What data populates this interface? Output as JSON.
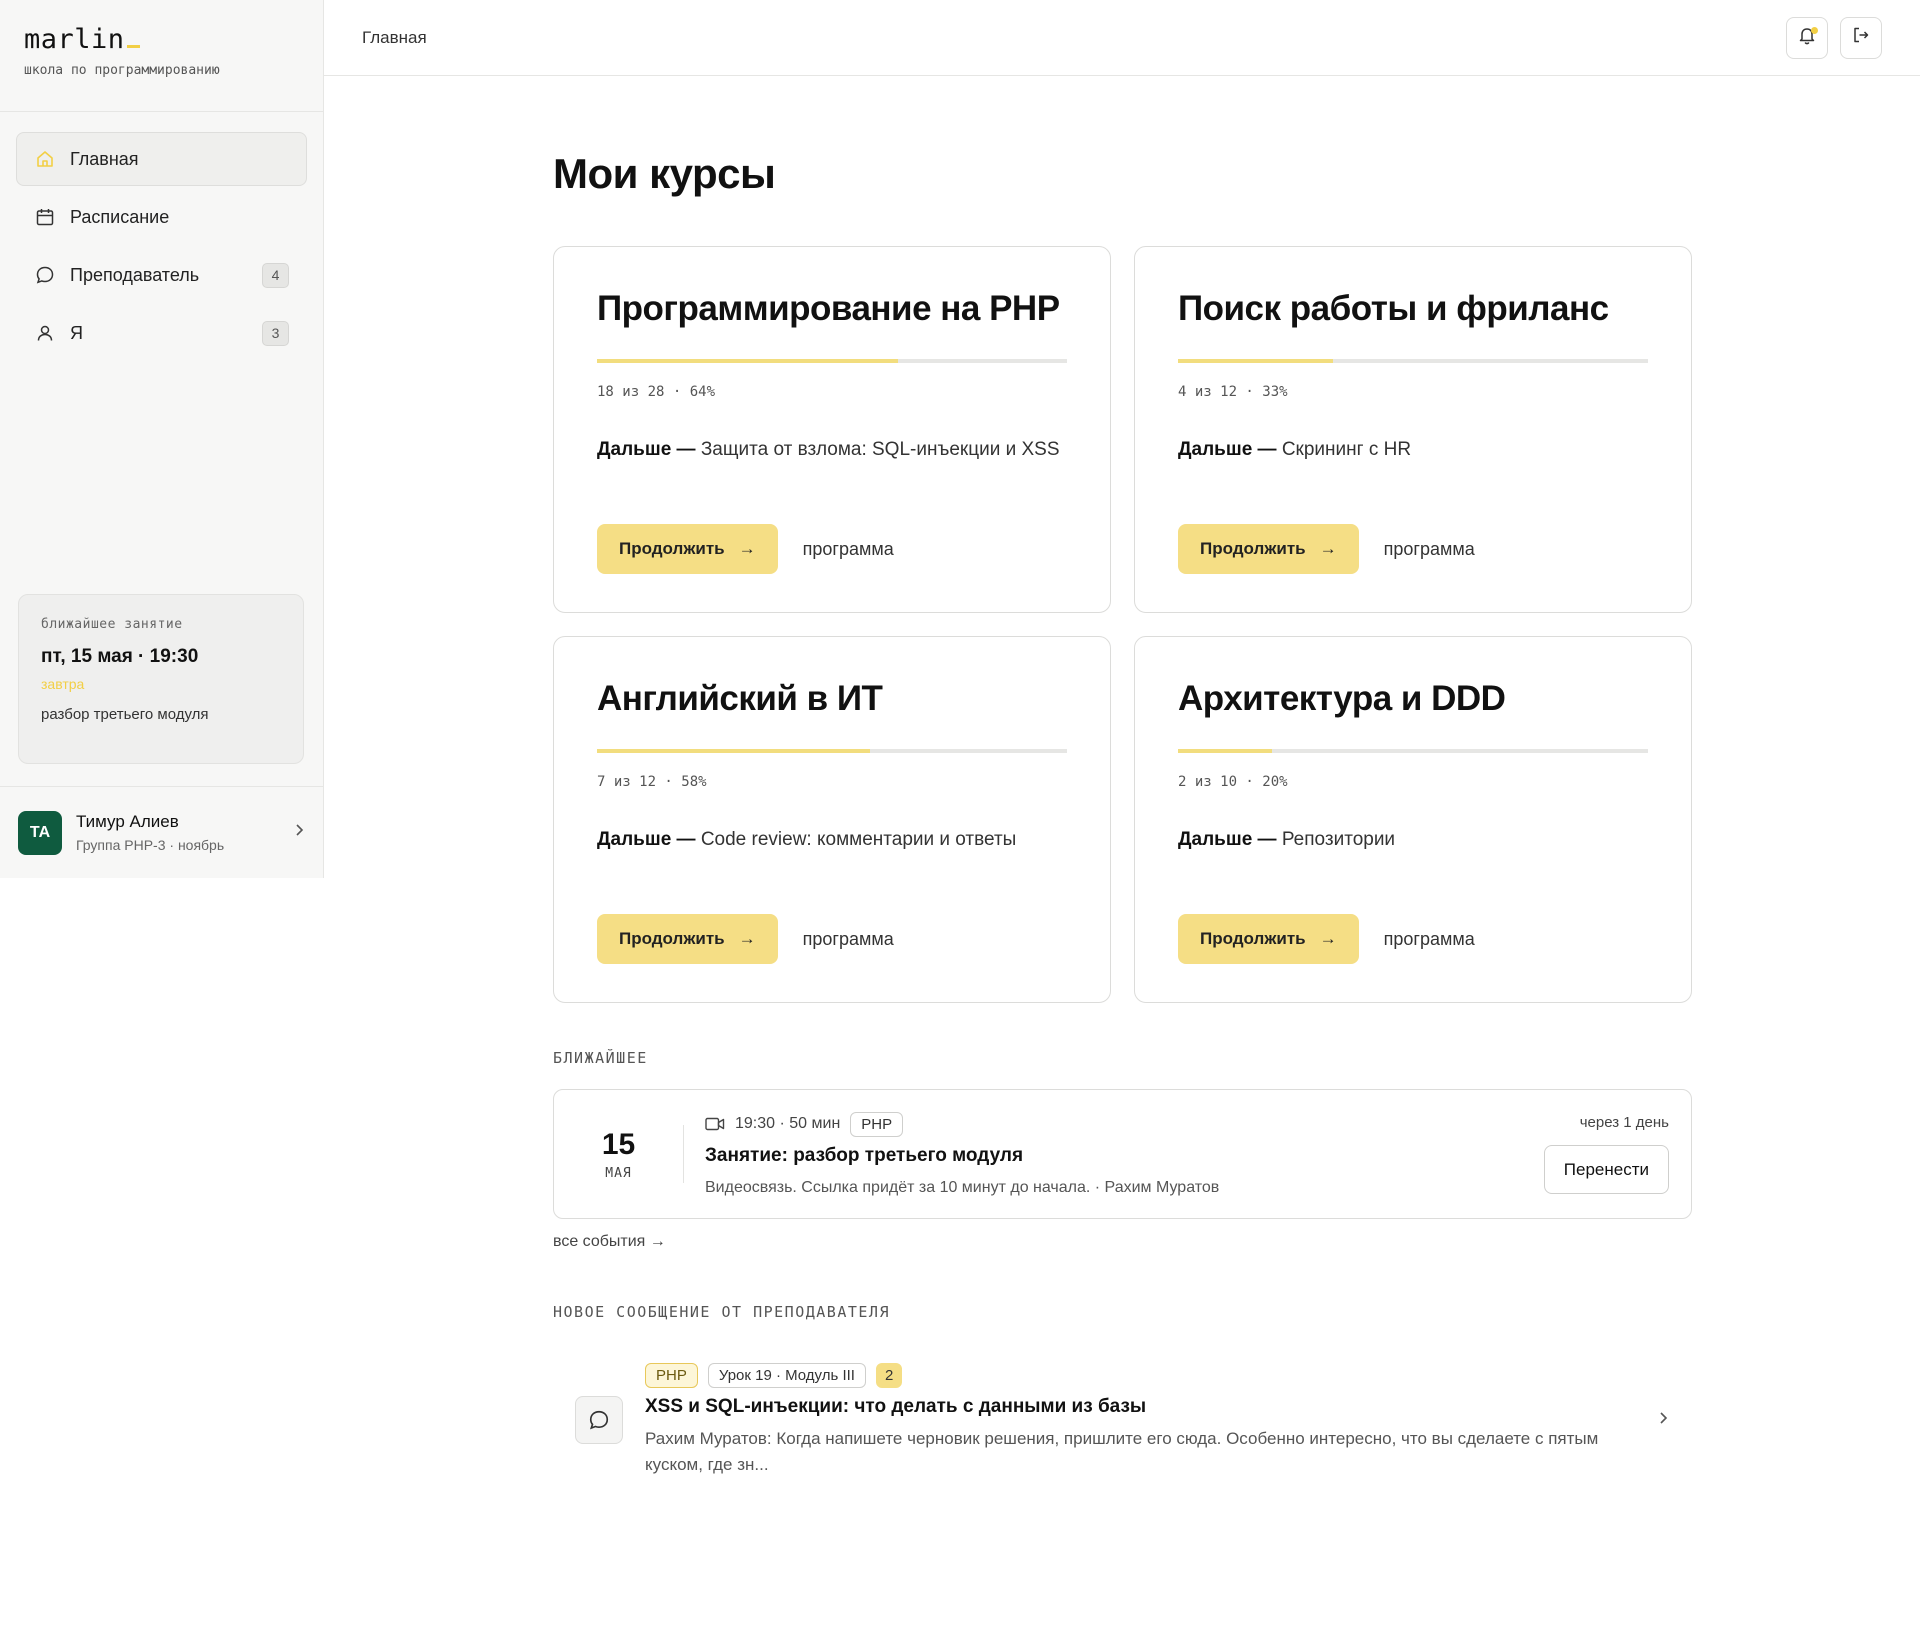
{
  "brand": {
    "name": "marlin",
    "tagline": "школа по программированию"
  },
  "sidebar": {
    "items": [
      {
        "label": "Главная",
        "icon": "home-icon",
        "active": true,
        "badge": null
      },
      {
        "label": "Расписание",
        "icon": "calendar-icon",
        "active": false,
        "badge": null
      },
      {
        "label": "Преподаватель",
        "icon": "chat-icon",
        "active": false,
        "badge": "4"
      },
      {
        "label": "Я",
        "icon": "user-icon",
        "active": false,
        "badge": "3"
      }
    ],
    "next_lesson": {
      "kicker": "ближайшее занятие",
      "date": "пт, 15 мая · 19:30",
      "when": "завтра",
      "topic": "разбор третьего модуля"
    },
    "user": {
      "initials": "ТА",
      "name": "Тимур Алиев",
      "group": "Группа PHP-3 · ноябрь"
    }
  },
  "header": {
    "breadcrumb": "Главная"
  },
  "main": {
    "title": "Мои курсы",
    "courses": [
      {
        "title": "Программирование на PHP",
        "done": 18,
        "total": 28,
        "percent": 64,
        "progress_text": "18 из 28 · 64%",
        "next_prefix": "Дальше —",
        "next_lesson": "Защита от взлома: SQL-инъекции и XSS",
        "continue_label": "Продолжить",
        "program_label": "программа"
      },
      {
        "title": "Поиск работы и фриланс",
        "done": 4,
        "total": 12,
        "percent": 33,
        "progress_text": "4 из 12 · 33%",
        "next_prefix": "Дальше —",
        "next_lesson": "Скрининг с HR",
        "continue_label": "Продолжить",
        "program_label": "программа"
      },
      {
        "title": "Английский в ИТ",
        "done": 7,
        "total": 12,
        "percent": 58,
        "progress_text": "7 из 12 · 58%",
        "next_prefix": "Дальше —",
        "next_lesson": "Code review: комментарии и ответы",
        "continue_label": "Продолжить",
        "program_label": "программа"
      },
      {
        "title": "Архитектура и DDD",
        "done": 2,
        "total": 10,
        "percent": 20,
        "progress_text": "2 из 10 · 20%",
        "next_prefix": "Дальше —",
        "next_lesson": "Репозитории",
        "continue_label": "Продолжить",
        "program_label": "программа"
      }
    ],
    "upcoming": {
      "label": "БЛИЖАЙШЕЕ",
      "day": "15",
      "month": "МАЯ",
      "time": "19:30 · 50 мин",
      "tag": "PHP",
      "title": "Занятие: разбор третьего модуля",
      "subtitle": "Видеосвязь. Ссылка придёт за 10 минут до начала. · Рахим Муратов",
      "until": "через 1 день",
      "reschedule_label": "Перенести",
      "all_events": "все события →"
    },
    "message": {
      "label": "НОВОЕ СООБЩЕНИЕ ОТ ПРЕПОДАВАТЕЛЯ",
      "tag_course": "PHP",
      "tag_lesson": "Урок 19 · Модуль III",
      "count": "2",
      "title": "XSS и SQL-инъекции: что делать с данными из базы",
      "text": "Рахим Муратов: Когда напишете черновик решения, пришлите его сюда. Особенно интересно, что вы сделаете с пятым куском, где зн..."
    }
  },
  "colors": {
    "accent": "#f5de85",
    "accent_strong": "#f2cf45",
    "avatar": "#0f5b3f",
    "border": "#dcdcda"
  }
}
